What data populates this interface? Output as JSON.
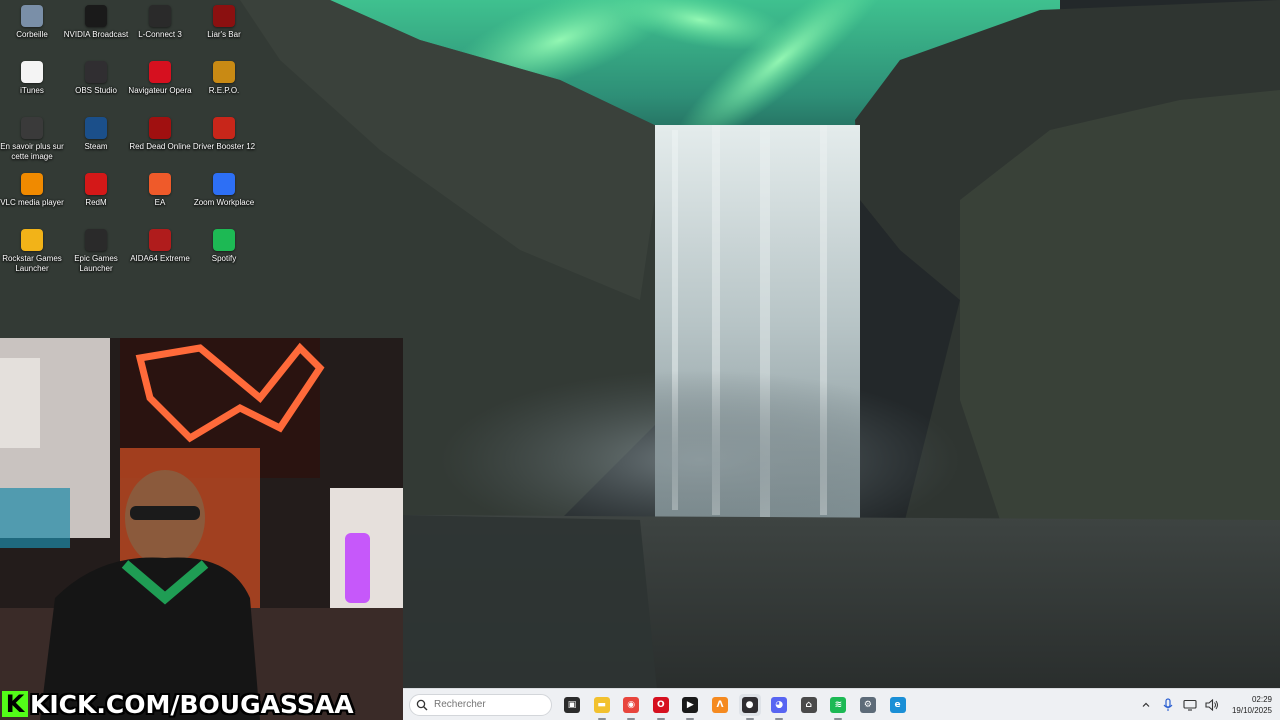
{
  "desktop": {
    "icons": [
      {
        "label": "Corbeille",
        "icon": "recycle-bin-icon",
        "color": "#7a8fa8"
      },
      {
        "label": "NVIDIA Broadcast",
        "icon": "nvidia-broadcast-icon",
        "color": "#1a1a1a"
      },
      {
        "label": "L-Connect 3",
        "icon": "l-connect-icon",
        "color": "#2a2a2a"
      },
      {
        "label": "Liar's Bar",
        "icon": "liars-bar-icon",
        "color": "#8b1010"
      },
      {
        "label": "iTunes",
        "icon": "itunes-icon",
        "color": "#f4f4f4"
      },
      {
        "label": "OBS Studio",
        "icon": "obs-studio-icon",
        "color": "#302e31"
      },
      {
        "label": "Navigateur Opera",
        "icon": "opera-icon",
        "color": "#d6101f"
      },
      {
        "label": "R.E.P.O.",
        "icon": "repo-icon",
        "color": "#c98a14"
      },
      {
        "label": "En savoir plus sur cette image",
        "icon": "camera-info-icon",
        "color": "#3a3a3a"
      },
      {
        "label": "Steam",
        "icon": "steam-icon",
        "color": "#1b4f8a"
      },
      {
        "label": "Red Dead Online",
        "icon": "red-dead-online-icon",
        "color": "#a01010"
      },
      {
        "label": "Driver Booster 12",
        "icon": "driver-booster-icon",
        "color": "#c8261a"
      },
      {
        "label": "VLC media player",
        "icon": "vlc-icon",
        "color": "#f08a00"
      },
      {
        "label": "RedM",
        "icon": "redm-icon",
        "color": "#d41818"
      },
      {
        "label": "EA",
        "icon": "ea-icon",
        "color": "#ef5a2a"
      },
      {
        "label": "Zoom Workplace",
        "icon": "zoom-icon",
        "color": "#2d6ff5"
      },
      {
        "label": "Rockstar Games Launcher",
        "icon": "rockstar-icon",
        "color": "#f2b318"
      },
      {
        "label": "Epic Games Launcher",
        "icon": "epic-games-icon",
        "color": "#2a2a2a"
      },
      {
        "label": "AIDA64 Extreme",
        "icon": "aida64-icon",
        "color": "#b01c1c"
      },
      {
        "label": "Spotify",
        "icon": "spotify-icon",
        "color": "#1db954"
      }
    ]
  },
  "overlay": {
    "kick_letter": "K",
    "kick_text": "KICK.COM/BOUGASSAA",
    "kick_color": "#53fc18"
  },
  "taskbar": {
    "search_placeholder": "Rechercher",
    "apps": [
      {
        "name": "task-view",
        "glyph": "▣",
        "color": "#2b2b2b"
      },
      {
        "name": "file-explorer",
        "glyph": "▬",
        "color": "#f2c12e"
      },
      {
        "name": "chrome",
        "glyph": "◉",
        "color": "#e8453c"
      },
      {
        "name": "opera",
        "glyph": "O",
        "color": "#d6101f"
      },
      {
        "name": "nvidia-broadcast",
        "glyph": "▶",
        "color": "#1a1a1a"
      },
      {
        "name": "app-orange",
        "glyph": "Λ",
        "color": "#f58a1f"
      },
      {
        "name": "obs-studio",
        "glyph": "●",
        "color": "#302e31"
      },
      {
        "name": "discord",
        "glyph": "◕",
        "color": "#5865f2"
      },
      {
        "name": "capture-tool",
        "glyph": "⌂",
        "color": "#4a4a4a"
      },
      {
        "name": "spotify",
        "glyph": "≋",
        "color": "#1db954"
      },
      {
        "name": "settings",
        "glyph": "⚙",
        "color": "#5d6b78"
      },
      {
        "name": "edge",
        "glyph": "e",
        "color": "#1a8fd6"
      }
    ],
    "time": "02:29",
    "date": "19/10/2025"
  }
}
